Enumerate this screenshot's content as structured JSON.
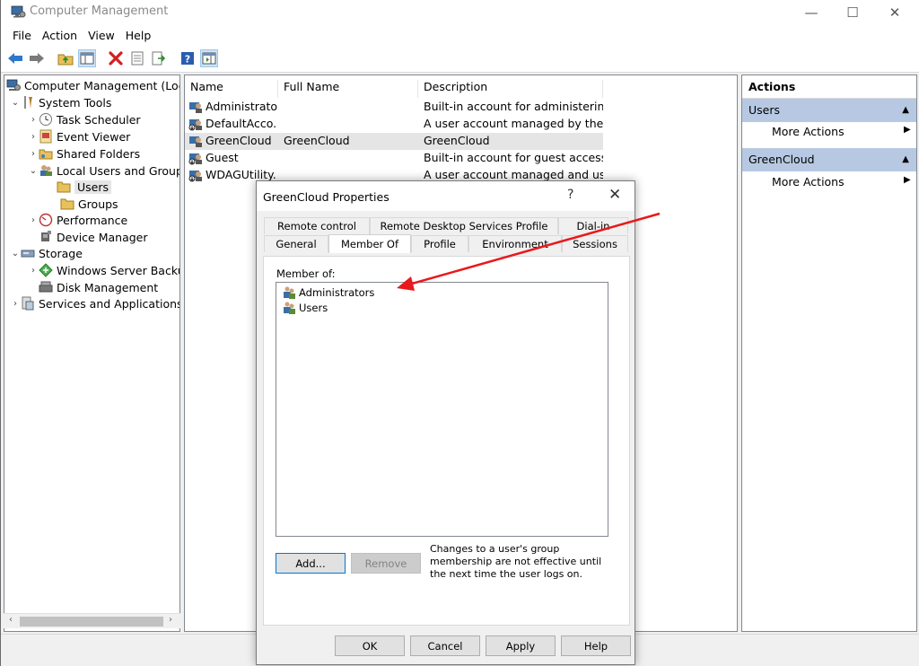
{
  "window": {
    "title": "Computer Management"
  },
  "menu": [
    "File",
    "Action",
    "View",
    "Help"
  ],
  "tree": {
    "root": "Computer Management (Local)",
    "system_tools": "System Tools",
    "task_scheduler": "Task Scheduler",
    "event_viewer": "Event Viewer",
    "shared_folders": "Shared Folders",
    "local_users_groups": "Local Users and Groups",
    "users": "Users",
    "groups": "Groups",
    "performance": "Performance",
    "device_manager": "Device Manager",
    "storage": "Storage",
    "windows_server_backup": "Windows Server Backup",
    "disk_management": "Disk Management",
    "services_apps": "Services and Applications"
  },
  "list": {
    "columns": [
      "Name",
      "Full Name",
      "Description"
    ],
    "rows": [
      {
        "name": "Administrator",
        "full_name": "",
        "description": "Built-in account for administering ..."
      },
      {
        "name": "DefaultAcco...",
        "full_name": "",
        "description": "A user account managed by the sy..."
      },
      {
        "name": "GreenCloud",
        "full_name": "GreenCloud",
        "description": "GreenCloud"
      },
      {
        "name": "Guest",
        "full_name": "",
        "description": "Built-in account for guest access t..."
      },
      {
        "name": "WDAGUtility...",
        "full_name": "",
        "description": "A user account managed and used..."
      }
    ]
  },
  "actions": {
    "header": "Actions",
    "section1": "Users",
    "section1_item": "More Actions",
    "section2": "GreenCloud",
    "section2_item": "More Actions"
  },
  "dialog": {
    "title": "GreenCloud Properties",
    "help": "?",
    "tabs_row1": [
      "Remote control",
      "Remote Desktop Services Profile",
      "Dial-in"
    ],
    "tabs_row2": [
      "General",
      "Member Of",
      "Profile",
      "Environment",
      "Sessions"
    ],
    "active_tab": "Member Of",
    "member_label": "Member of:",
    "members": [
      "Administrators",
      "Users"
    ],
    "add_button": "Add...",
    "remove_button": "Remove",
    "note": "Changes to a user's group membership are not effective until the next time the user logs on.",
    "ok": "OK",
    "cancel": "Cancel",
    "apply": "Apply",
    "help_button": "Help"
  },
  "colors": {
    "annotation_arrow": "#e8191c",
    "section_header": "#b7c9e2",
    "selection": "#e5e5e5"
  }
}
